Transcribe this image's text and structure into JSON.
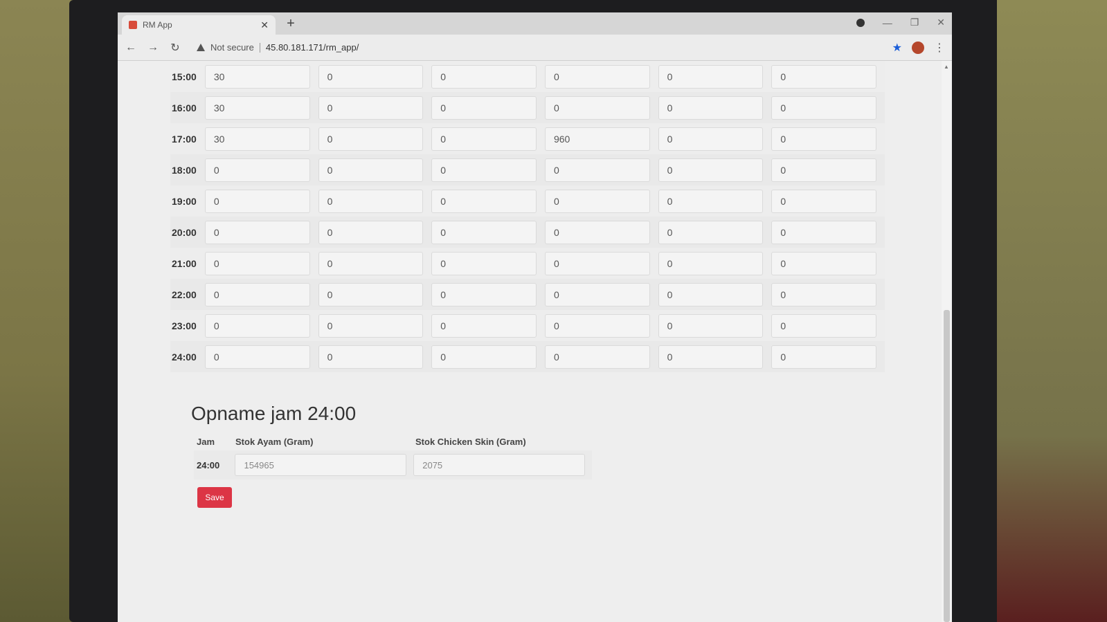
{
  "browser": {
    "tab_title": "RM App",
    "not_secure": "Not secure",
    "url": "45.80.181.171/rm_app/"
  },
  "grid_rows": [
    {
      "hour": "15:00",
      "values": [
        "30",
        "0",
        "0",
        "0",
        "0",
        "0"
      ]
    },
    {
      "hour": "16:00",
      "values": [
        "30",
        "0",
        "0",
        "0",
        "0",
        "0"
      ]
    },
    {
      "hour": "17:00",
      "values": [
        "30",
        "0",
        "0",
        "960",
        "0",
        "0"
      ]
    },
    {
      "hour": "18:00",
      "values": [
        "0",
        "0",
        "0",
        "0",
        "0",
        "0"
      ]
    },
    {
      "hour": "19:00",
      "values": [
        "0",
        "0",
        "0",
        "0",
        "0",
        "0"
      ]
    },
    {
      "hour": "20:00",
      "values": [
        "0",
        "0",
        "0",
        "0",
        "0",
        "0"
      ]
    },
    {
      "hour": "21:00",
      "values": [
        "0",
        "0",
        "0",
        "0",
        "0",
        "0"
      ]
    },
    {
      "hour": "22:00",
      "values": [
        "0",
        "0",
        "0",
        "0",
        "0",
        "0"
      ]
    },
    {
      "hour": "23:00",
      "values": [
        "0",
        "0",
        "0",
        "0",
        "0",
        "0"
      ]
    },
    {
      "hour": "24:00",
      "values": [
        "0",
        "0",
        "0",
        "0",
        "0",
        "0"
      ]
    }
  ],
  "opname": {
    "title": "Opname jam 24:00",
    "headers": [
      "Jam",
      "Stok Ayam (Gram)",
      "Stok Chicken Skin (Gram)"
    ],
    "jam": "24:00",
    "stok_ayam": "154965",
    "stok_chicken_skin": "2075",
    "save_label": "Save"
  },
  "colors": {
    "save_button": "#dc3545",
    "bookmark_star": "#1a5dd8"
  }
}
